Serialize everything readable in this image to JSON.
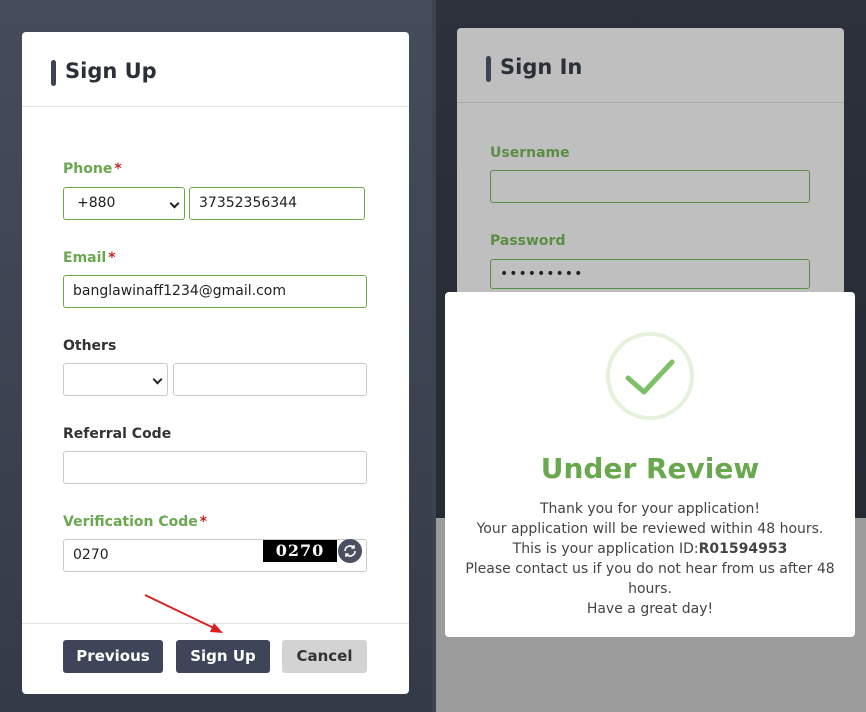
{
  "signup": {
    "title": "Sign Up",
    "phone": {
      "label": "Phone",
      "required": "*",
      "country_code": "+880",
      "value": "37352356344"
    },
    "email": {
      "label": "Email",
      "required": "*",
      "value": "banglawinaff1234@gmail.com"
    },
    "others": {
      "label": "Others",
      "select_value": "",
      "value": ""
    },
    "referral": {
      "label": "Referral Code",
      "value": ""
    },
    "verification": {
      "label": "Verification Code",
      "required": "*",
      "value": "0270",
      "captcha": "0270"
    },
    "buttons": {
      "previous": "Previous",
      "signup": "Sign Up",
      "cancel": "Cancel"
    }
  },
  "signin": {
    "title": "Sign In",
    "username": {
      "label": "Username",
      "value": ""
    },
    "password": {
      "label": "Password",
      "value": "•••••••••"
    }
  },
  "modal": {
    "title": "Under Review",
    "line1": "Thank you for your application!",
    "line2": "Your application will be reviewed within 48 hours.",
    "line3_prefix": "This is your application ID:",
    "application_id": "R01594953",
    "line4a": "Please contact us if you do not hear from us after 48",
    "line4b": "hours.",
    "line5": "Have a great day!"
  },
  "colors": {
    "accent_green": "#6aa84f",
    "button_dark": "#3f4558",
    "required_red": "#c0272d",
    "arrow_red": "#e02020"
  },
  "icons": [
    "check-icon",
    "refresh-icon",
    "chevron-down-icon",
    "annotation-arrow-icon"
  ]
}
